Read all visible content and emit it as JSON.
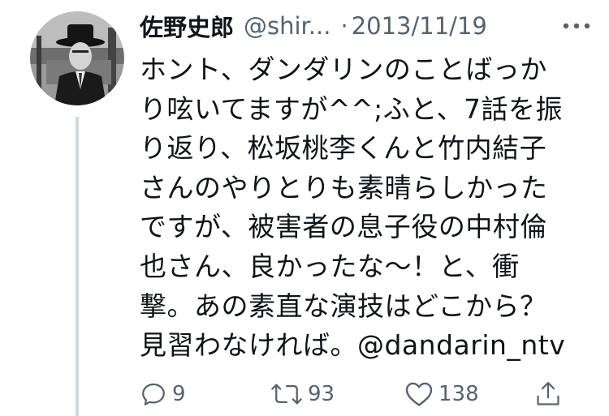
{
  "author": {
    "name": "佐野史郎",
    "handle": "@shir...",
    "separator": "·",
    "date": "2013/11/19"
  },
  "tweet": {
    "lines": [
      "ホント、ダンダリンのことばっか",
      "り呟いてますが^^;ふと、7話を振",
      "り返り、松坂桃李くんと竹内結子",
      "さんのやりとりも素晴らしかった",
      "ですが、被害者の息子役の中村倫",
      "也さん、良かったな〜！と、衝",
      "撃。あの素直な演技はどこから？",
      "見習わなければ。@dandarin_ntv"
    ]
  },
  "actions": {
    "reply_count": "9",
    "retweet_count": "93",
    "like_count": "138"
  },
  "icons": {
    "more": "more-icon",
    "reply": "reply-icon",
    "retweet": "retweet-icon",
    "like": "heart-icon",
    "share": "share-icon"
  },
  "colors": {
    "text": "#0f1419",
    "secondary": "#536471",
    "thread_line": "#cfd9de"
  }
}
